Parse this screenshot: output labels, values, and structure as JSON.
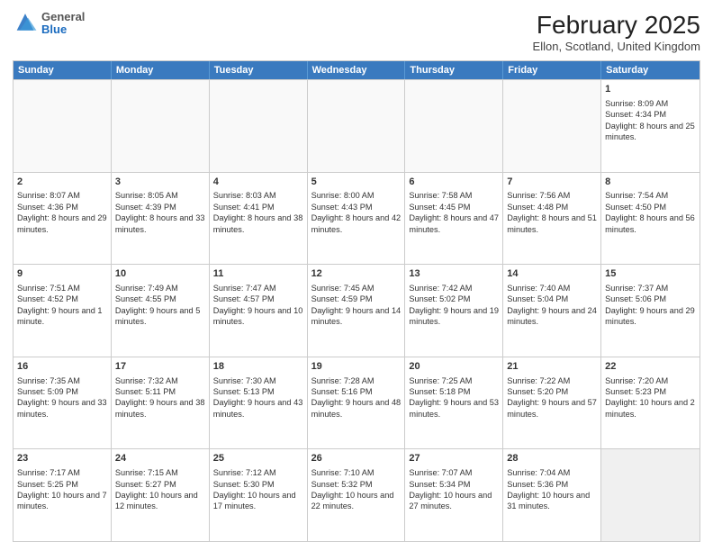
{
  "logo": {
    "general": "General",
    "blue": "Blue"
  },
  "header": {
    "month": "February 2025",
    "location": "Ellon, Scotland, United Kingdom"
  },
  "days": [
    "Sunday",
    "Monday",
    "Tuesday",
    "Wednesday",
    "Thursday",
    "Friday",
    "Saturday"
  ],
  "rows": [
    [
      {
        "day": "",
        "empty": true
      },
      {
        "day": "",
        "empty": true
      },
      {
        "day": "",
        "empty": true
      },
      {
        "day": "",
        "empty": true
      },
      {
        "day": "",
        "empty": true
      },
      {
        "day": "",
        "empty": true
      },
      {
        "day": "1",
        "sunrise": "Sunrise: 8:09 AM",
        "sunset": "Sunset: 4:34 PM",
        "daylight": "Daylight: 8 hours and 25 minutes."
      }
    ],
    [
      {
        "day": "2",
        "sunrise": "Sunrise: 8:07 AM",
        "sunset": "Sunset: 4:36 PM",
        "daylight": "Daylight: 8 hours and 29 minutes."
      },
      {
        "day": "3",
        "sunrise": "Sunrise: 8:05 AM",
        "sunset": "Sunset: 4:39 PM",
        "daylight": "Daylight: 8 hours and 33 minutes."
      },
      {
        "day": "4",
        "sunrise": "Sunrise: 8:03 AM",
        "sunset": "Sunset: 4:41 PM",
        "daylight": "Daylight: 8 hours and 38 minutes."
      },
      {
        "day": "5",
        "sunrise": "Sunrise: 8:00 AM",
        "sunset": "Sunset: 4:43 PM",
        "daylight": "Daylight: 8 hours and 42 minutes."
      },
      {
        "day": "6",
        "sunrise": "Sunrise: 7:58 AM",
        "sunset": "Sunset: 4:45 PM",
        "daylight": "Daylight: 8 hours and 47 minutes."
      },
      {
        "day": "7",
        "sunrise": "Sunrise: 7:56 AM",
        "sunset": "Sunset: 4:48 PM",
        "daylight": "Daylight: 8 hours and 51 minutes."
      },
      {
        "day": "8",
        "sunrise": "Sunrise: 7:54 AM",
        "sunset": "Sunset: 4:50 PM",
        "daylight": "Daylight: 8 hours and 56 minutes."
      }
    ],
    [
      {
        "day": "9",
        "sunrise": "Sunrise: 7:51 AM",
        "sunset": "Sunset: 4:52 PM",
        "daylight": "Daylight: 9 hours and 1 minute."
      },
      {
        "day": "10",
        "sunrise": "Sunrise: 7:49 AM",
        "sunset": "Sunset: 4:55 PM",
        "daylight": "Daylight: 9 hours and 5 minutes."
      },
      {
        "day": "11",
        "sunrise": "Sunrise: 7:47 AM",
        "sunset": "Sunset: 4:57 PM",
        "daylight": "Daylight: 9 hours and 10 minutes."
      },
      {
        "day": "12",
        "sunrise": "Sunrise: 7:45 AM",
        "sunset": "Sunset: 4:59 PM",
        "daylight": "Daylight: 9 hours and 14 minutes."
      },
      {
        "day": "13",
        "sunrise": "Sunrise: 7:42 AM",
        "sunset": "Sunset: 5:02 PM",
        "daylight": "Daylight: 9 hours and 19 minutes."
      },
      {
        "day": "14",
        "sunrise": "Sunrise: 7:40 AM",
        "sunset": "Sunset: 5:04 PM",
        "daylight": "Daylight: 9 hours and 24 minutes."
      },
      {
        "day": "15",
        "sunrise": "Sunrise: 7:37 AM",
        "sunset": "Sunset: 5:06 PM",
        "daylight": "Daylight: 9 hours and 29 minutes."
      }
    ],
    [
      {
        "day": "16",
        "sunrise": "Sunrise: 7:35 AM",
        "sunset": "Sunset: 5:09 PM",
        "daylight": "Daylight: 9 hours and 33 minutes."
      },
      {
        "day": "17",
        "sunrise": "Sunrise: 7:32 AM",
        "sunset": "Sunset: 5:11 PM",
        "daylight": "Daylight: 9 hours and 38 minutes."
      },
      {
        "day": "18",
        "sunrise": "Sunrise: 7:30 AM",
        "sunset": "Sunset: 5:13 PM",
        "daylight": "Daylight: 9 hours and 43 minutes."
      },
      {
        "day": "19",
        "sunrise": "Sunrise: 7:28 AM",
        "sunset": "Sunset: 5:16 PM",
        "daylight": "Daylight: 9 hours and 48 minutes."
      },
      {
        "day": "20",
        "sunrise": "Sunrise: 7:25 AM",
        "sunset": "Sunset: 5:18 PM",
        "daylight": "Daylight: 9 hours and 53 minutes."
      },
      {
        "day": "21",
        "sunrise": "Sunrise: 7:22 AM",
        "sunset": "Sunset: 5:20 PM",
        "daylight": "Daylight: 9 hours and 57 minutes."
      },
      {
        "day": "22",
        "sunrise": "Sunrise: 7:20 AM",
        "sunset": "Sunset: 5:23 PM",
        "daylight": "Daylight: 10 hours and 2 minutes."
      }
    ],
    [
      {
        "day": "23",
        "sunrise": "Sunrise: 7:17 AM",
        "sunset": "Sunset: 5:25 PM",
        "daylight": "Daylight: 10 hours and 7 minutes."
      },
      {
        "day": "24",
        "sunrise": "Sunrise: 7:15 AM",
        "sunset": "Sunset: 5:27 PM",
        "daylight": "Daylight: 10 hours and 12 minutes."
      },
      {
        "day": "25",
        "sunrise": "Sunrise: 7:12 AM",
        "sunset": "Sunset: 5:30 PM",
        "daylight": "Daylight: 10 hours and 17 minutes."
      },
      {
        "day": "26",
        "sunrise": "Sunrise: 7:10 AM",
        "sunset": "Sunset: 5:32 PM",
        "daylight": "Daylight: 10 hours and 22 minutes."
      },
      {
        "day": "27",
        "sunrise": "Sunrise: 7:07 AM",
        "sunset": "Sunset: 5:34 PM",
        "daylight": "Daylight: 10 hours and 27 minutes."
      },
      {
        "day": "28",
        "sunrise": "Sunrise: 7:04 AM",
        "sunset": "Sunset: 5:36 PM",
        "daylight": "Daylight: 10 hours and 31 minutes."
      },
      {
        "day": "",
        "empty": true,
        "shaded": true
      }
    ]
  ]
}
